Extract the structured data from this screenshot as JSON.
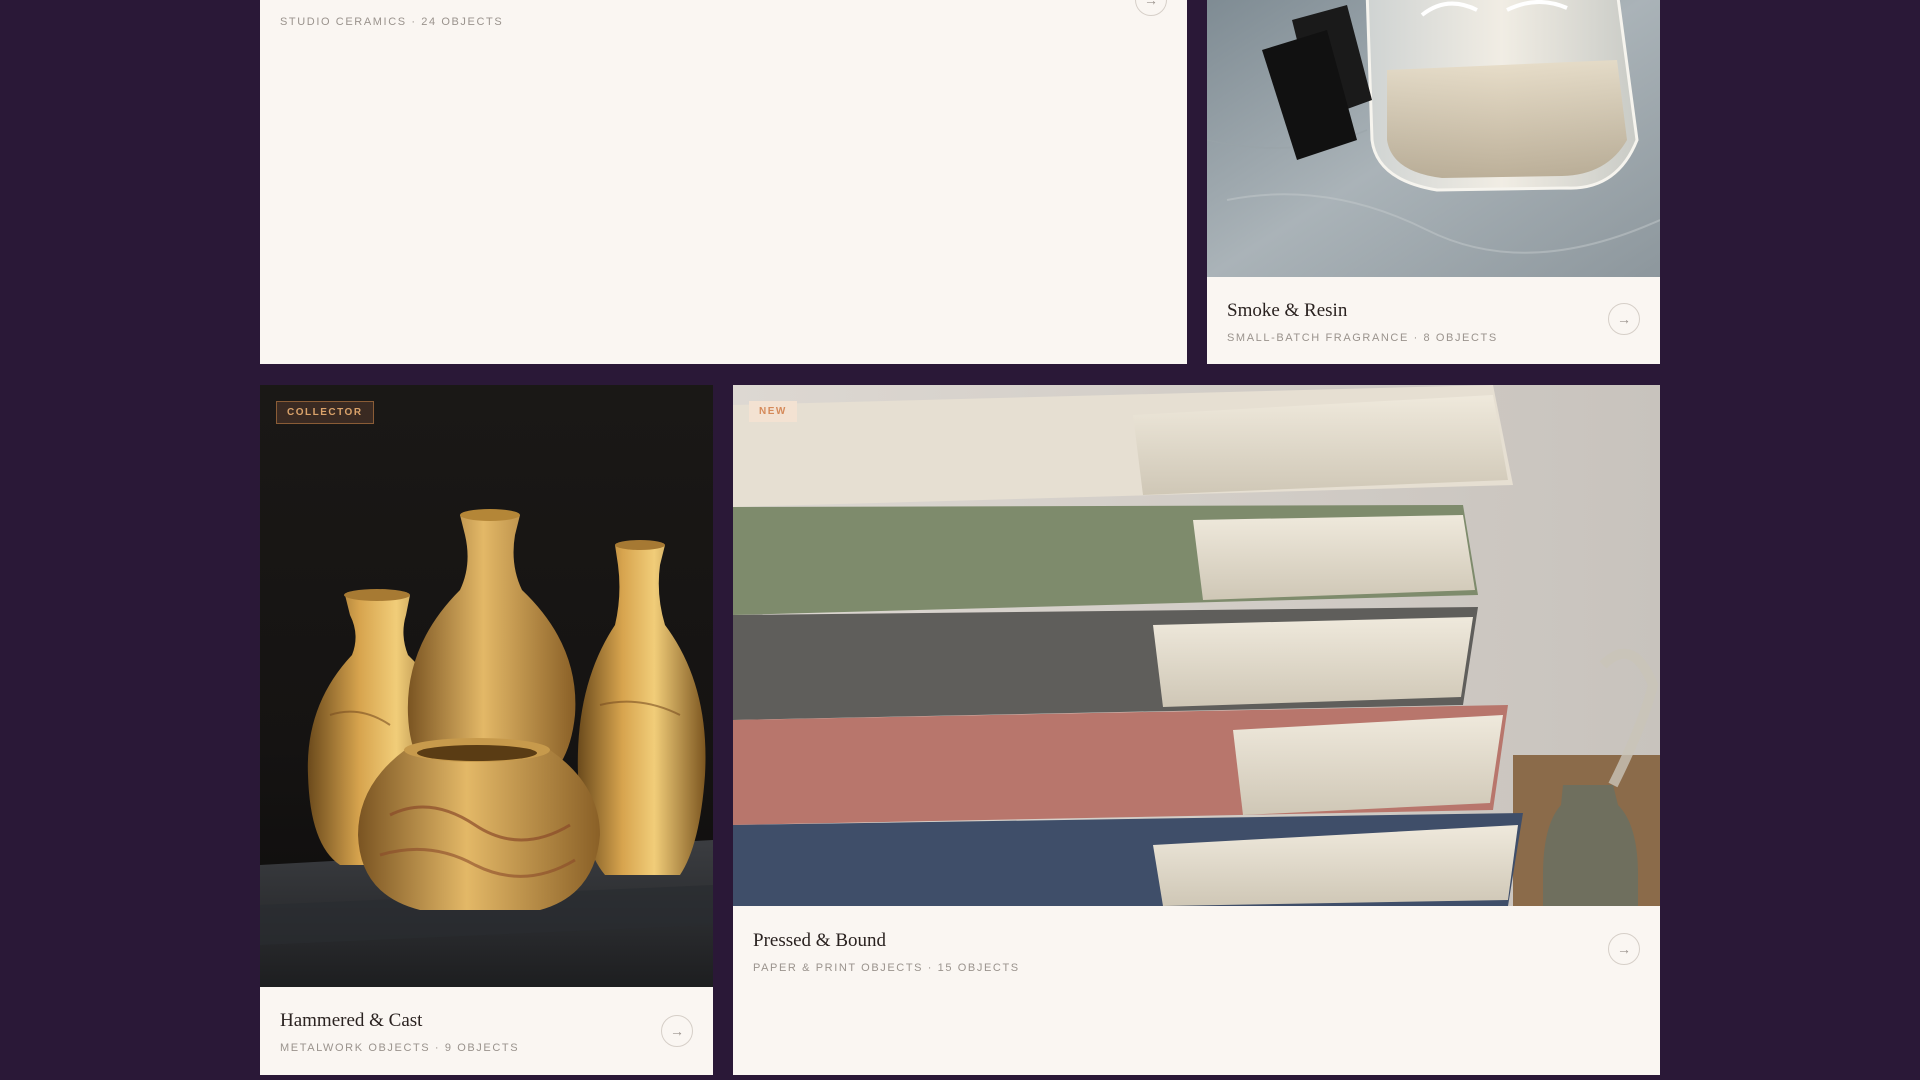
{
  "cards": {
    "ceramics": {
      "meta": "STUDIO CERAMICS · 24 OBJECTS",
      "arrow": "→"
    },
    "smoke": {
      "title": "Smoke & Resin",
      "meta": "SMALL-BATCH FRAGRANCE · 8 OBJECTS",
      "arrow": "→"
    },
    "hammered": {
      "badge": "COLLECTOR",
      "title": "Hammered & Cast",
      "meta": "METALWORK OBJECTS · 9 OBJECTS",
      "arrow": "→"
    },
    "pressed": {
      "badge": "NEW",
      "title": "Pressed & Bound",
      "meta": "PAPER & PRINT OBJECTS · 15 OBJECTS",
      "arrow": "→"
    }
  },
  "colors": {
    "page_background": "#2a1837",
    "card_background": "#faf6f2",
    "badge_collector": "#d9a26a",
    "badge_new": "#d58a5a"
  }
}
